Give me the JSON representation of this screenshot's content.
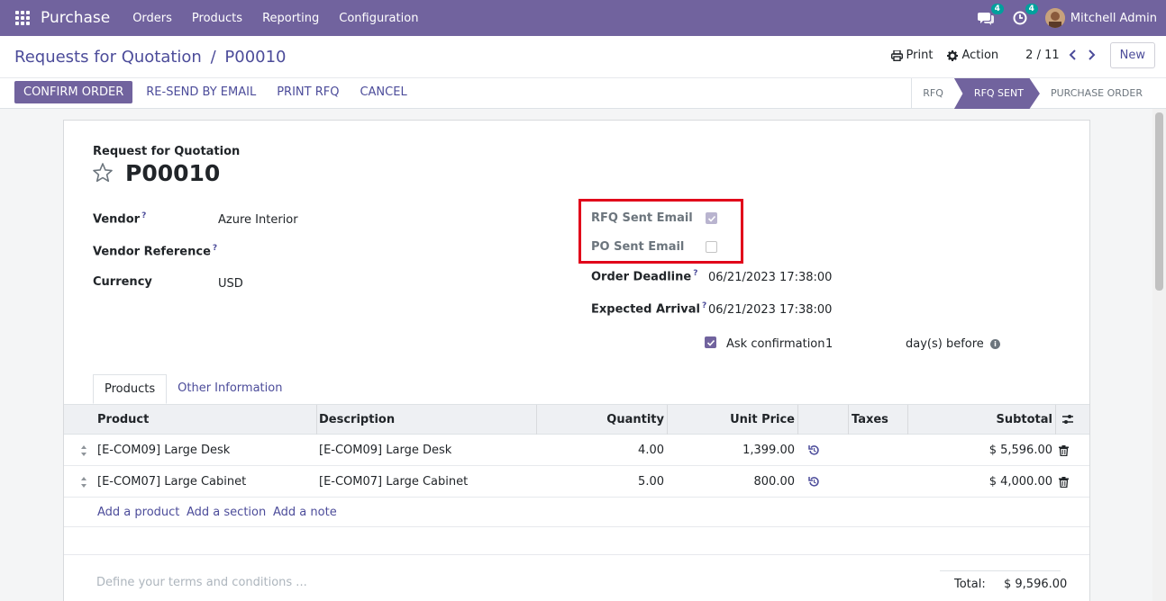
{
  "navbar": {
    "app_name": "Purchase",
    "menu": [
      "Orders",
      "Products",
      "Reporting",
      "Configuration"
    ],
    "messages_badge": "4",
    "activities_badge": "4",
    "user_name": "Mitchell Admin"
  },
  "control_panel": {
    "breadcrumb_parent": "Requests for Quotation",
    "breadcrumb_sep": "/",
    "breadcrumb_current": "P00010",
    "print_label": "Print",
    "action_label": "Action",
    "pager": "2 / 11",
    "new_label": "New"
  },
  "statusbar": {
    "buttons": [
      "CONFIRM ORDER",
      "RE-SEND BY EMAIL",
      "PRINT RFQ",
      "CANCEL"
    ],
    "steps": [
      "RFQ",
      "RFQ SENT",
      "PURCHASE ORDER"
    ],
    "active_step": "RFQ SENT"
  },
  "form": {
    "title_label": "Request for Quotation",
    "record_name": "P00010",
    "vendor_label": "Vendor",
    "vendor_value": "Azure Interior",
    "vendor_ref_label": "Vendor Reference",
    "currency_label": "Currency",
    "currency_value": "USD",
    "rfq_sent_email_label": "RFQ Sent Email",
    "rfq_sent_email_checked": true,
    "po_sent_email_label": "PO Sent Email",
    "po_sent_email_checked": false,
    "order_deadline_label": "Order Deadline",
    "order_deadline_value": "06/21/2023 17:38:00",
    "expected_arrival_label": "Expected Arrival",
    "expected_arrival_value": "06/21/2023 17:38:00",
    "ask_confirmation_label": "Ask confirmation",
    "ask_confirmation_days": "1",
    "days_before_label": "day(s) before",
    "help_mark": "?"
  },
  "tabs": [
    "Products",
    "Other Information"
  ],
  "table": {
    "headers": [
      "Product",
      "Description",
      "Quantity",
      "Unit Price",
      "Taxes",
      "Subtotal"
    ],
    "rows": [
      {
        "product": "[E-COM09] Large Desk",
        "description": "[E-COM09] Large Desk",
        "quantity": "4.00",
        "unit_price": "1,399.00",
        "taxes": "",
        "subtotal": "$ 5,596.00"
      },
      {
        "product": "[E-COM07] Large Cabinet",
        "description": "[E-COM07] Large Cabinet",
        "quantity": "5.00",
        "unit_price": "800.00",
        "taxes": "",
        "subtotal": "$ 4,000.00"
      }
    ],
    "add_product": "Add a product",
    "add_section": "Add a section",
    "add_note": "Add a note"
  },
  "footer": {
    "terms_placeholder": "Define your terms and conditions ...",
    "total_label": "Total:",
    "total_value": "$ 9,596.00"
  },
  "colors": {
    "brand": "#71639e",
    "link": "#4c4c9a",
    "highlight": "#e1001a"
  }
}
